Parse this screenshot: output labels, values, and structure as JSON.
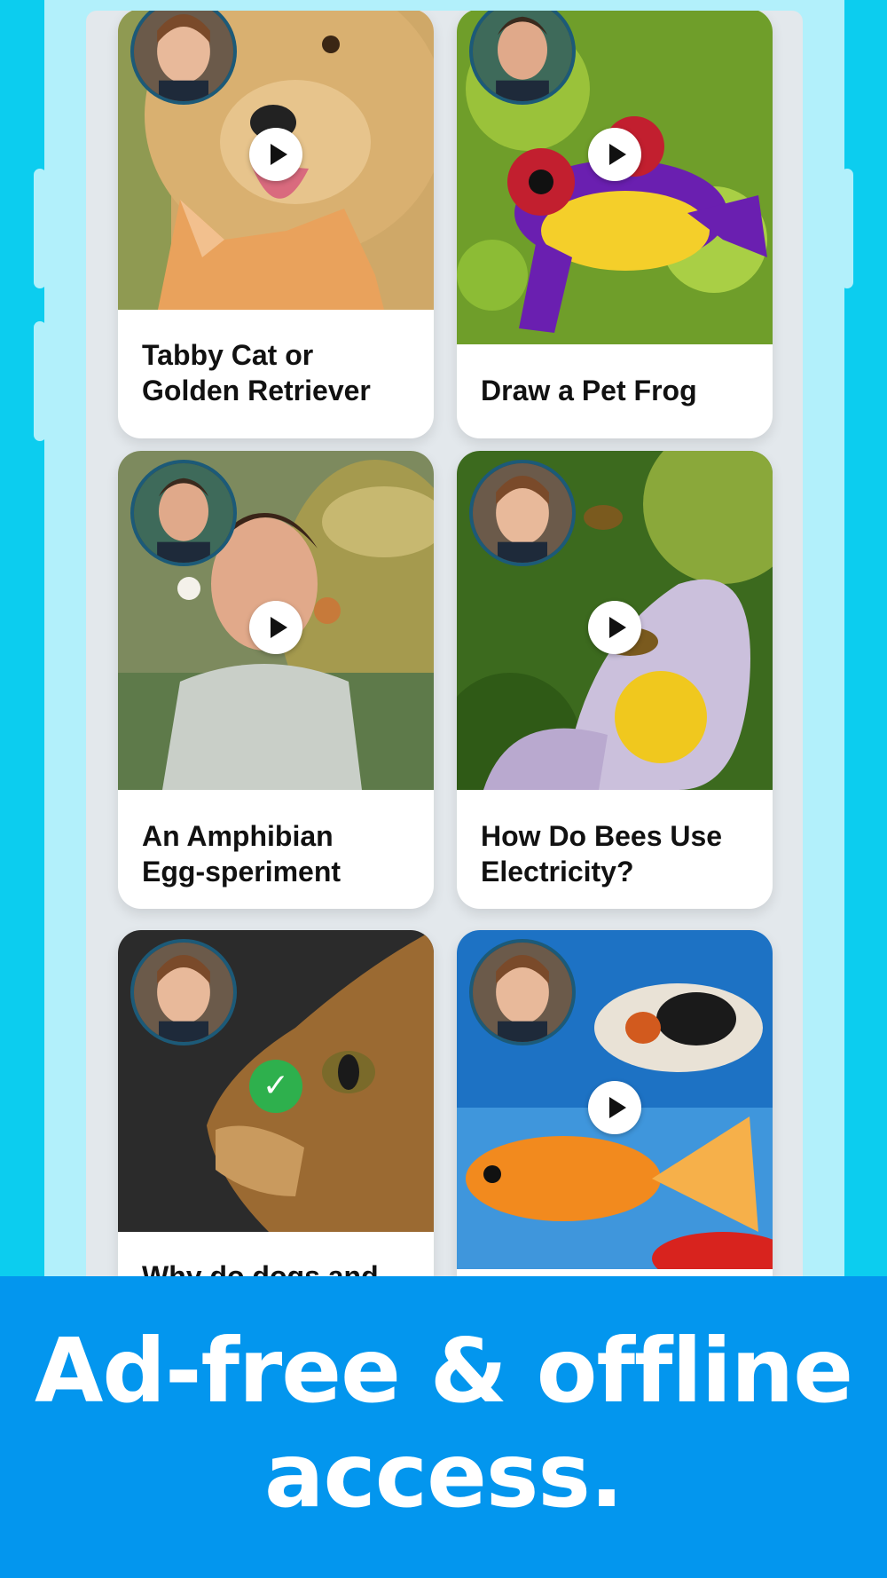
{
  "banner": {
    "text": "Ad-free & offline\naccess."
  },
  "icons": {
    "play": "play-icon",
    "completed": "checkmark-icon"
  },
  "colors": {
    "background": "#0ccdef",
    "banner": "#0396ee",
    "completed": "#2eb04d"
  },
  "cards": [
    {
      "title": "Tabby Cat or\nGolden Retriever",
      "status": "play"
    },
    {
      "title": "Draw a Pet Frog",
      "status": "play"
    },
    {
      "title": "An Amphibian\nEgg-speriment",
      "status": "play"
    },
    {
      "title": "How Do Bees Use\nElectricity?",
      "status": "play"
    },
    {
      "title": "Why do dogs and",
      "status": "completed"
    },
    {
      "title": "",
      "status": "play"
    }
  ]
}
